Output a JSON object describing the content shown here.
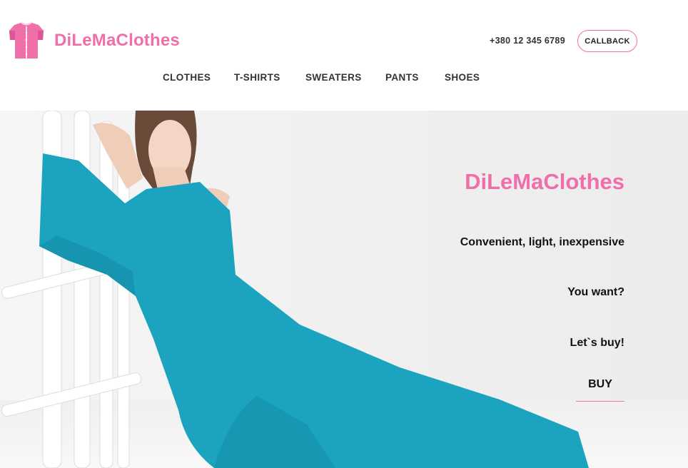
{
  "brand": {
    "name": "DiLeMaClothes",
    "color": "#f06eaa",
    "icon": "shirt-icon"
  },
  "contact": {
    "phone": "+380 12 345 6789",
    "callback_label": "CALLBACK"
  },
  "nav": {
    "items": [
      {
        "label": "CLOTHES"
      },
      {
        "label": "T-SHIRTS"
      },
      {
        "label": "SWEATERS"
      },
      {
        "label": "PANTS"
      },
      {
        "label": "SHOES"
      }
    ]
  },
  "hero": {
    "title": "DiLeMaClothes",
    "line1": "Convenient, light, inexpensive",
    "line2": "You want?",
    "line3": "Let`s buy!",
    "buy_label": "BUY",
    "dress_color": "#1ba3c0"
  }
}
